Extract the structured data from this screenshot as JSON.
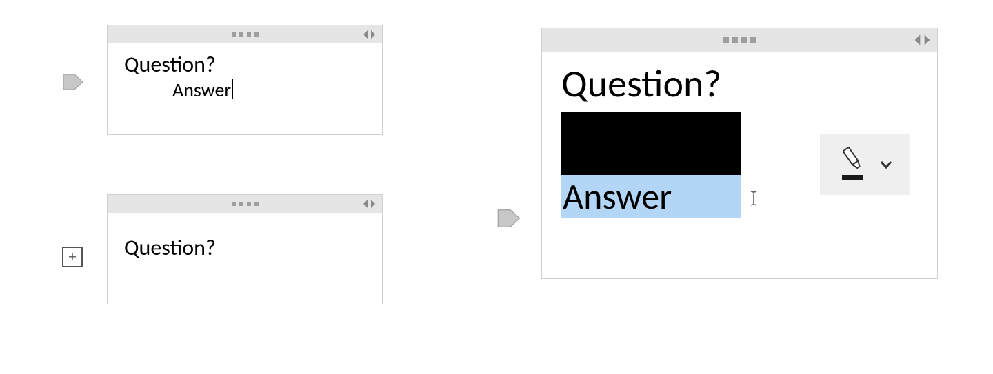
{
  "panels": {
    "topLeft": {
      "question": "Question?",
      "answer": "Answer"
    },
    "bottomLeft": {
      "question": "Question?"
    },
    "right": {
      "question": "Question?",
      "answer": "Answer"
    }
  },
  "icons": {
    "plus": "+",
    "pointer": "pointer-tag",
    "navLeft": "◀",
    "navRight": "▶",
    "dropdown": "⌄",
    "ibeam": "I"
  },
  "colors": {
    "highlight": "#b3d6f6",
    "occluder": "#000000",
    "panelHeader": "#e5e5e5",
    "toolFloat": "#efefef"
  }
}
